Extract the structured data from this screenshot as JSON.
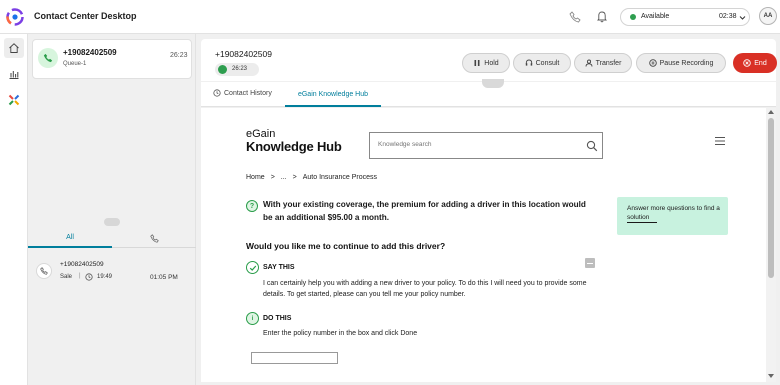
{
  "header": {
    "app_title": "Contact Center Desktop",
    "status": {
      "label": "Available",
      "time": "02:38",
      "color": "#2e9e4f"
    },
    "avatar_initials": "AA"
  },
  "task_list": {
    "active_task": {
      "number": "+19082402509",
      "queue": "Queue-1",
      "timer": "26:23"
    },
    "tabs": {
      "all_label": "All"
    },
    "history": [
      {
        "number": "+19082402509",
        "type": "Sale",
        "duration": "19:49",
        "time": "01:05 PM"
      }
    ]
  },
  "interaction": {
    "number": "+19082402509",
    "timer": "26:23",
    "buttons": {
      "hold": "Hold",
      "consult": "Consult",
      "transfer": "Transfer",
      "pause_recording": "Pause Recording",
      "end": "End"
    },
    "end_color": "#d93025",
    "tabs": [
      "Contact History",
      "eGain Knowledge Hub"
    ]
  },
  "egain": {
    "logo_line1": "eGain",
    "logo_line2": "Knowledge Hub",
    "search_placeholder": "Knowledge search",
    "breadcrumb": [
      "Home",
      ">",
      "...",
      ">",
      "Auto Insurance Process"
    ],
    "answer": "With your existing coverage, the premium for adding a driver in this location would be an additional $95.00 a month.",
    "more_questions": "Answer more questions to find a solution",
    "question": "Would you like me to continue to add this driver?",
    "say_this": {
      "heading": "SAY THIS",
      "text": "I can certainly help you with adding a new driver to your policy. To do this I will need you to provide some details.  To get started, please can you tell me your policy number."
    },
    "do_this": {
      "heading": "DO THIS",
      "text": "Enter the policy number in the box and click Done"
    },
    "accent_color": "#2a9d4a",
    "card_color": "#c8f2df"
  }
}
